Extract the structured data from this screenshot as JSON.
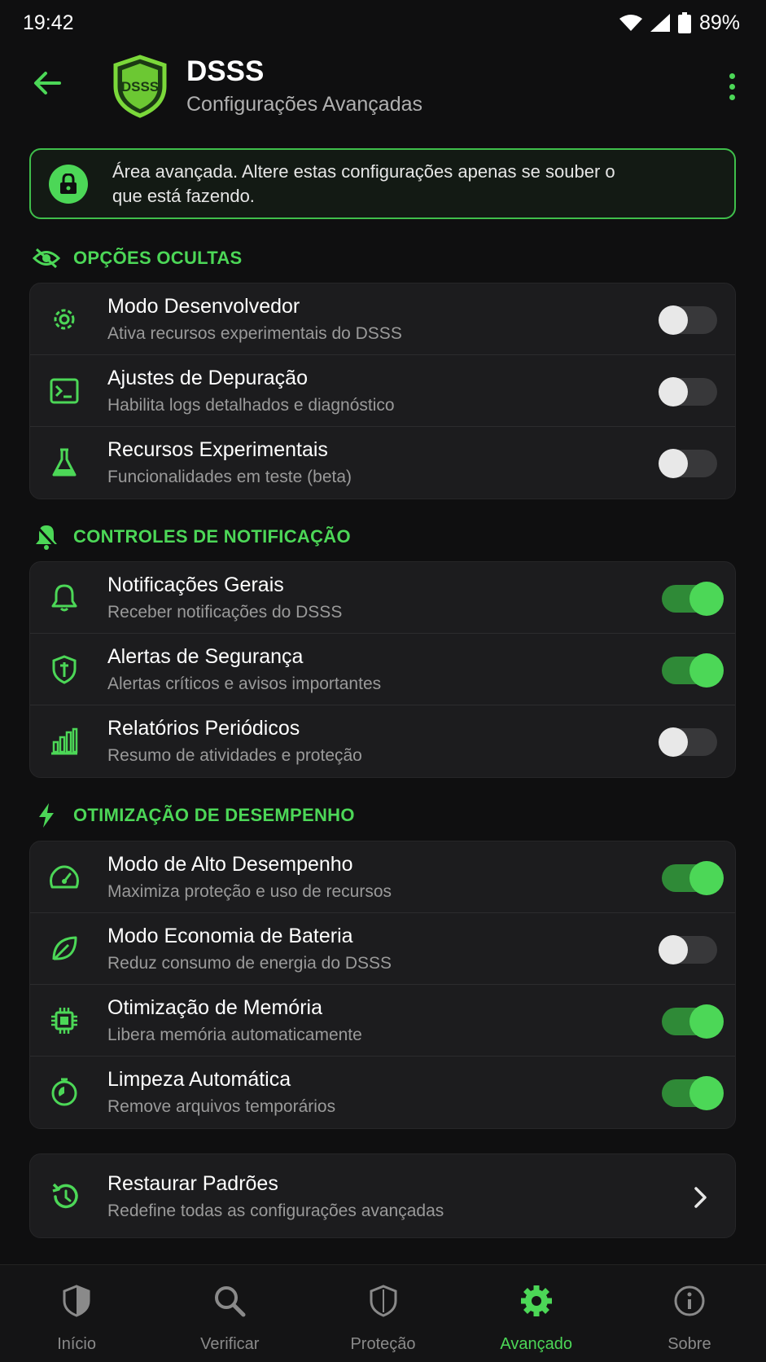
{
  "status_bar": {
    "time": "19:42",
    "battery": "89%"
  },
  "app_bar": {
    "logo_text": "DSSS",
    "title": "DSSS",
    "subtitle": "Configurações Avançadas"
  },
  "warning": {
    "text": "Área avançada. Altere estas configurações apenas se souber o que está fazendo."
  },
  "sections": [
    {
      "title": "OPÇÕES OCULTAS",
      "icon": "eye-off-icon",
      "items": [
        {
          "title": "Modo Desenvolvedor",
          "subtitle": "Ativa recursos experimentais do DSSS",
          "icon": "gear-icon",
          "enabled": false
        },
        {
          "title": "Ajustes de Depuração",
          "subtitle": "Habilita logs detalhados e diagnóstico",
          "icon": "terminal-icon",
          "enabled": false
        },
        {
          "title": "Recursos Experimentais",
          "subtitle": "Funcionalidades em teste (beta)",
          "icon": "flask-icon",
          "enabled": false
        }
      ]
    },
    {
      "title": "CONTROLES DE NOTIFICAÇÃO",
      "icon": "bell-icon",
      "items": [
        {
          "title": "Notificações Gerais",
          "subtitle": "Receber notificações do DSSS",
          "icon": "bell-outline-icon",
          "enabled": true
        },
        {
          "title": "Alertas de Segurança",
          "subtitle": "Alertas críticos e avisos importantes",
          "icon": "shield-icon",
          "enabled": true
        },
        {
          "title": "Relatórios Periódicos",
          "subtitle": "Resumo de atividades e proteção",
          "icon": "bar-chart-icon",
          "enabled": false
        }
      ]
    },
    {
      "title": "OTIMIZAÇÃO DE DESEMPENHO",
      "icon": "lightning-icon",
      "items": [
        {
          "title": "Modo de Alto Desempenho",
          "subtitle": "Maximiza proteção e uso de recursos",
          "icon": "speedometer-icon",
          "enabled": true
        },
        {
          "title": "Modo Economia de Bateria",
          "subtitle": "Reduz consumo de energia do DSSS",
          "icon": "leaf-icon",
          "enabled": false
        },
        {
          "title": "Otimização de Memória",
          "subtitle": "Libera memória automaticamente",
          "icon": "chip-icon",
          "enabled": true
        },
        {
          "title": "Limpeza Automática",
          "subtitle": "Remove arquivos temporários",
          "icon": "clock-cleanup-icon",
          "enabled": true
        }
      ]
    }
  ],
  "restore": {
    "title": "Restaurar Padrões",
    "subtitle": "Redefine todas as configurações avançadas",
    "icon": "restore-icon"
  },
  "bottom_nav": [
    {
      "label": "Início",
      "icon": "shield-half-icon",
      "active": false
    },
    {
      "label": "Verificar",
      "icon": "search-icon",
      "active": false
    },
    {
      "label": "Proteção",
      "icon": "shield-outline-icon",
      "active": false
    },
    {
      "label": "Avançado",
      "icon": "gear-icon",
      "active": true
    },
    {
      "label": "Sobre",
      "icon": "info-icon",
      "active": false
    }
  ],
  "colors": {
    "accent": "#4cd757",
    "background": "#0f0f10",
    "card": "#1c1c1e"
  }
}
